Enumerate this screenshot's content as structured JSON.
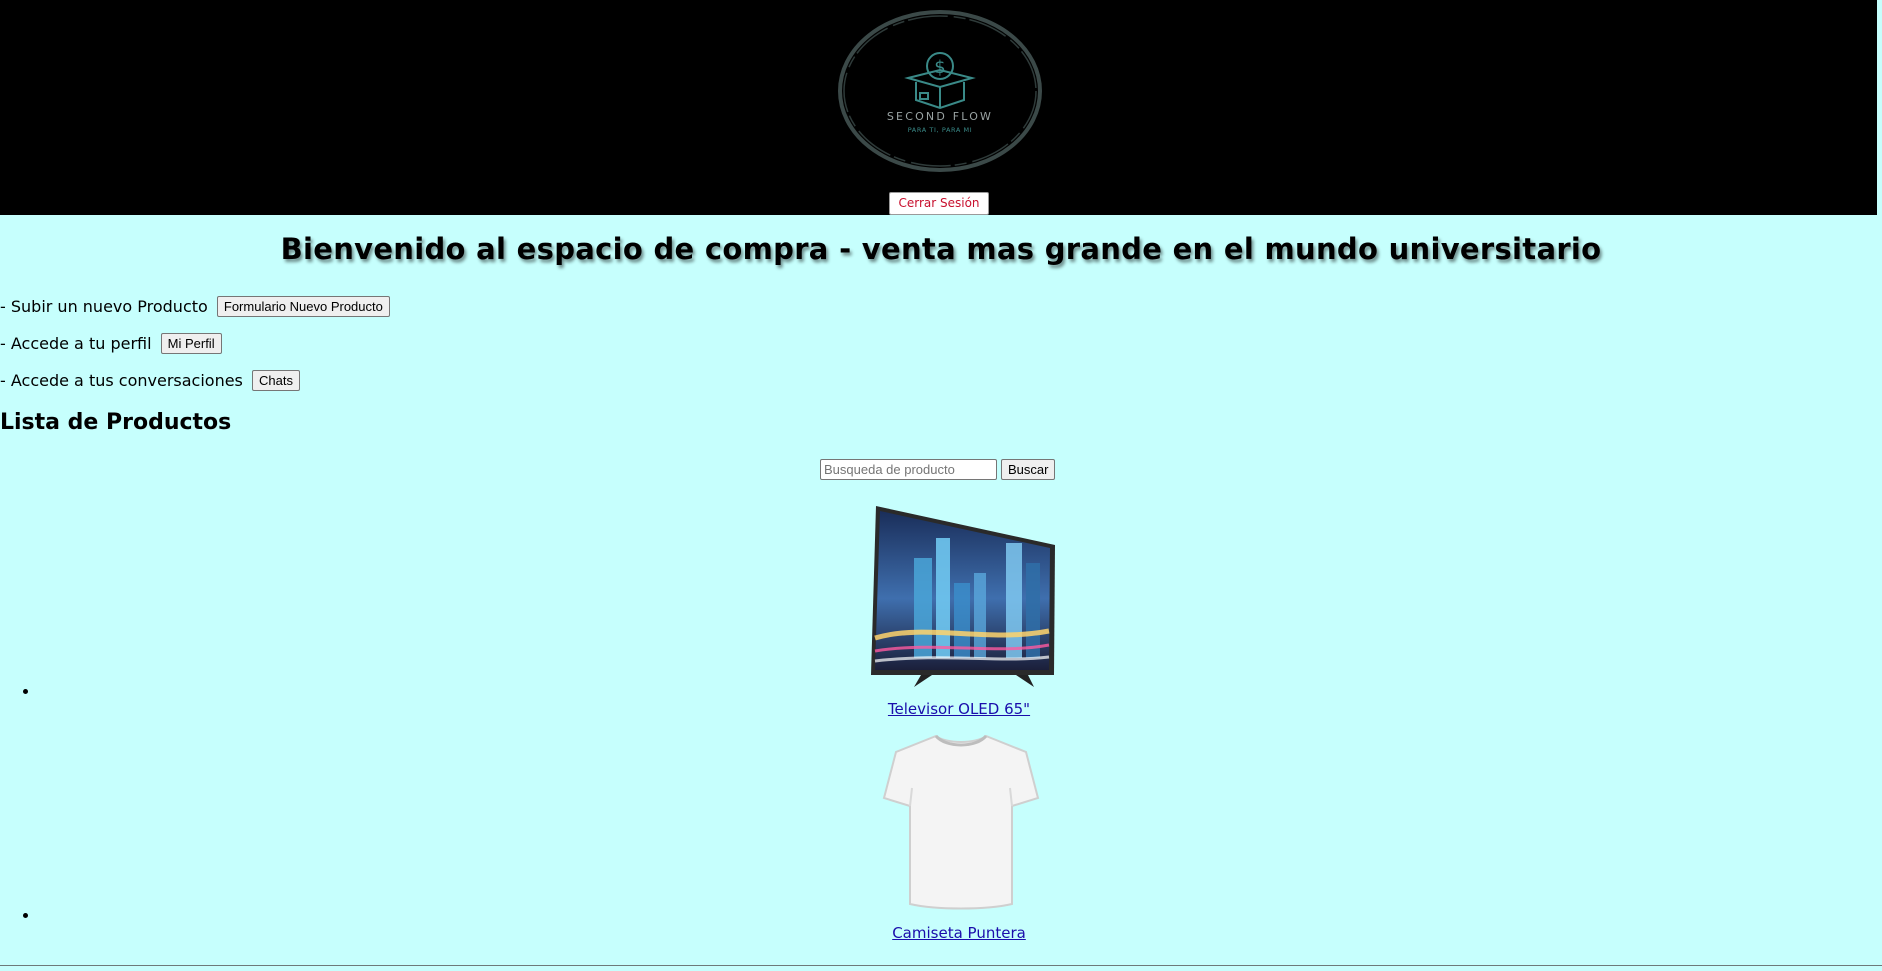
{
  "header": {
    "logo": {
      "brand": "SECOND FLOW",
      "tagline": "PARA TI, PARA MI",
      "icon": "dollar-box-icon"
    },
    "logout_label": "Cerrar Sesión"
  },
  "welcome": "Bienvenido al espacio de compra - venta mas grande en el mundo universitario",
  "actions": [
    {
      "text": "- Subir un nuevo Producto",
      "button": "Formulario Nuevo Producto"
    },
    {
      "text": "- Accede a tu perfil",
      "button": "Mi Perfil"
    },
    {
      "text": "- Accede a tus conversaciones",
      "button": "Chats"
    }
  ],
  "products_title": "Lista de Productos",
  "search": {
    "placeholder": "Busqueda de producto",
    "button": "Buscar"
  },
  "products": [
    {
      "name": "Televisor OLED 65\"",
      "image": "television-image"
    },
    {
      "name": "Camiseta Puntera",
      "image": "tshirt-image"
    }
  ],
  "colors": {
    "page_background": "#c6fffd",
    "header_background": "#000000",
    "logout_text": "#c8102e",
    "link": "#1a0dab",
    "logo_teal": "#3a8a88"
  }
}
